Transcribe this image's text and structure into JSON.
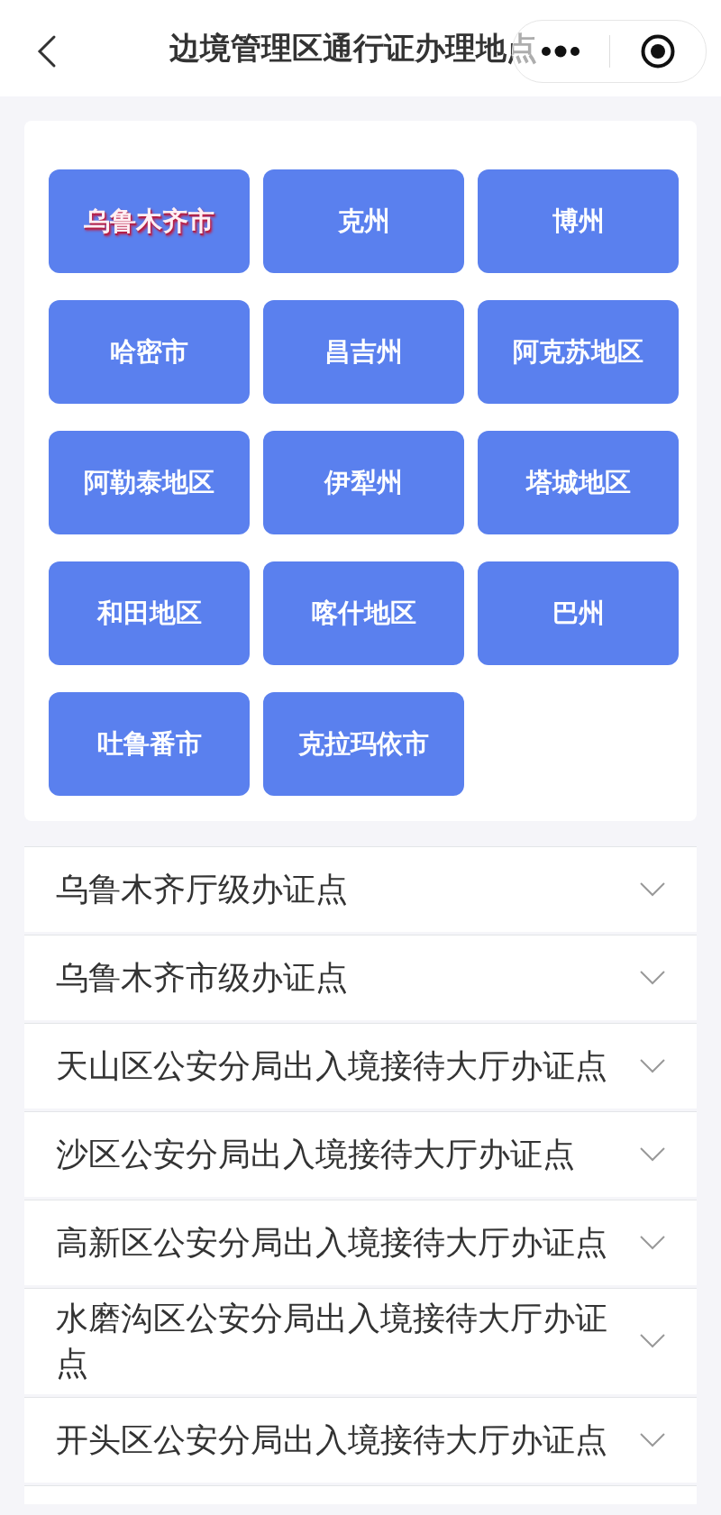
{
  "header": {
    "title": "边境管理区通行证办理地点"
  },
  "regions": [
    {
      "label": "乌鲁木齐市",
      "selected": true
    },
    {
      "label": "克州",
      "selected": false
    },
    {
      "label": "博州",
      "selected": false
    },
    {
      "label": "哈密市",
      "selected": false
    },
    {
      "label": "昌吉州",
      "selected": false
    },
    {
      "label": "阿克苏地区",
      "selected": false
    },
    {
      "label": "阿勒泰地区",
      "selected": false
    },
    {
      "label": "伊犁州",
      "selected": false
    },
    {
      "label": "塔城地区",
      "selected": false
    },
    {
      "label": "和田地区",
      "selected": false
    },
    {
      "label": "喀什地区",
      "selected": false
    },
    {
      "label": "巴州",
      "selected": false
    },
    {
      "label": "吐鲁番市",
      "selected": false
    },
    {
      "label": "克拉玛依市",
      "selected": false
    }
  ],
  "offices": [
    {
      "name": "乌鲁木齐厅级办证点",
      "expanded": false
    },
    {
      "name": "乌鲁木齐市级办证点",
      "expanded": false
    },
    {
      "name": "天山区公安分局出入境接待大厅办证点",
      "expanded": false
    },
    {
      "name": "沙区公安分局出入境接待大厅办证点",
      "expanded": false
    },
    {
      "name": "高新区公安分局出入境接待大厅办证点",
      "expanded": false
    },
    {
      "name": "水磨沟区公安分局出入境接待大厅办证点",
      "expanded": false
    },
    {
      "name": "开头区公安分局出入境接待大厅办证点",
      "expanded": false
    }
  ]
}
